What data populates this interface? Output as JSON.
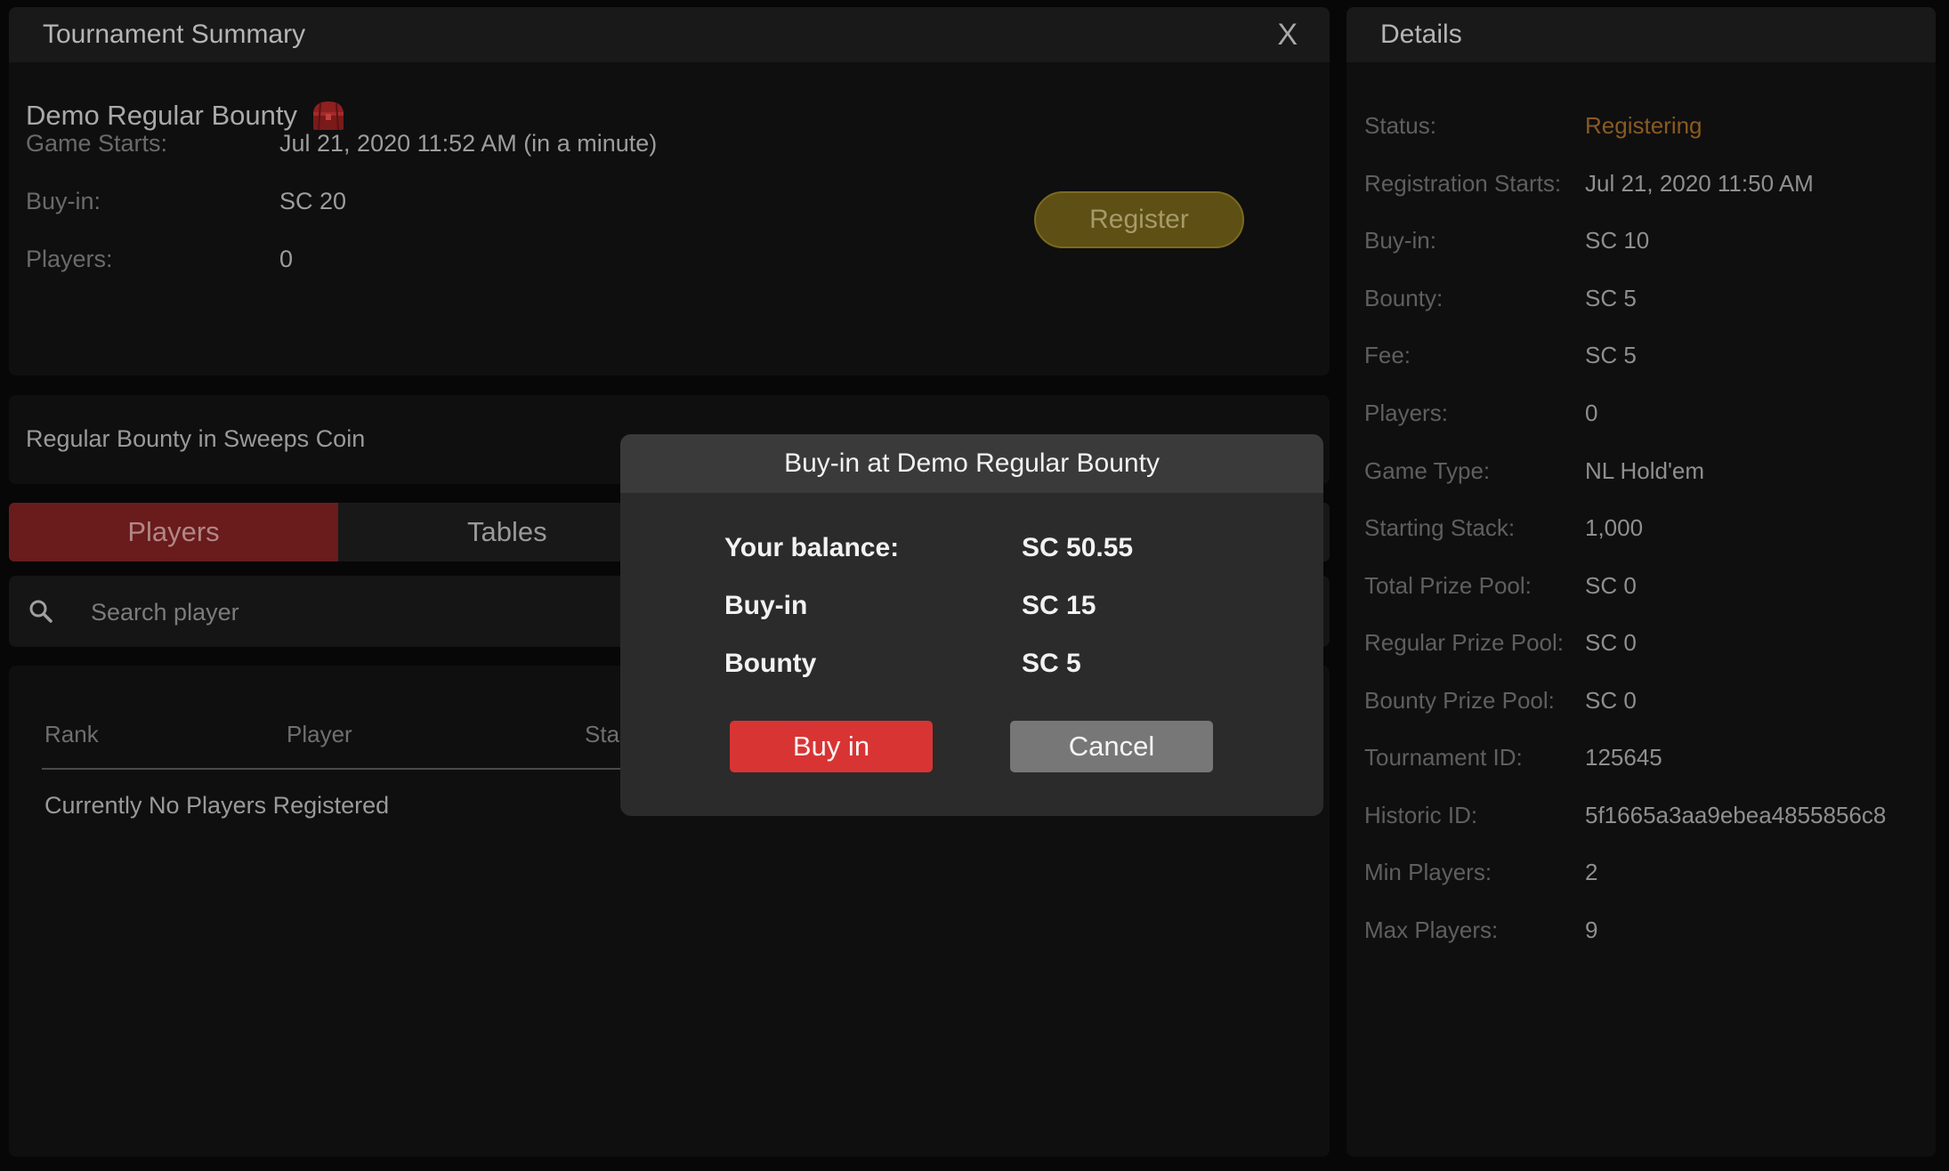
{
  "summary": {
    "title": "Tournament Summary",
    "close_label": "X",
    "tournament_name": "Demo Regular Bounty",
    "rows": [
      {
        "label": "Game Starts:",
        "value": "Jul 21, 2020 11:52 AM (in a minute)"
      },
      {
        "label": "Buy-in:",
        "value": "SC 20"
      },
      {
        "label": "Players:",
        "value": "0"
      }
    ],
    "register_label": "Register"
  },
  "description": "Regular Bounty in Sweeps Coin",
  "tabs": {
    "players": "Players",
    "tables": "Tables"
  },
  "search": {
    "placeholder": "Search player"
  },
  "table": {
    "headers": [
      "Rank",
      "Player",
      "Stack"
    ],
    "empty_message": "Currently No Players Registered"
  },
  "details": {
    "title": "Details",
    "rows": [
      {
        "label": "Status:",
        "value": "Registering"
      },
      {
        "label": "Registration Starts:",
        "value": "Jul 21, 2020 11:50 AM"
      },
      {
        "label": "Buy-in:",
        "value": "SC 10"
      },
      {
        "label": "Bounty:",
        "value": "SC 5"
      },
      {
        "label": "Fee:",
        "value": "SC 5"
      },
      {
        "label": "Players:",
        "value": "0"
      },
      {
        "label": "Game Type:",
        "value": "NL Hold'em"
      },
      {
        "label": "Starting Stack:",
        "value": "1,000"
      },
      {
        "label": "Total Prize Pool:",
        "value": "SC 0"
      },
      {
        "label": "Regular Prize Pool:",
        "value": "SC 0"
      },
      {
        "label": "Bounty Prize Pool:",
        "value": "SC 0"
      },
      {
        "label": "Tournament ID:",
        "value": "125645"
      },
      {
        "label": "Historic ID:",
        "value": "5f1665a3aa9ebea4855856c8"
      },
      {
        "label": "Min Players:",
        "value": "2"
      },
      {
        "label": "Max Players:",
        "value": "9"
      }
    ]
  },
  "modal": {
    "title": "Buy-in at Demo Regular Bounty",
    "rows": [
      {
        "label": "Your balance:",
        "value": "SC 50.55"
      },
      {
        "label": "Buy-in",
        "value": "SC 15"
      },
      {
        "label": "Bounty",
        "value": "SC 5"
      }
    ],
    "buyin_label": "Buy in",
    "cancel_label": "Cancel"
  },
  "colors": {
    "accent_red": "#d83434",
    "tab_active": "#6a1b1b",
    "register_gold": "#5e4f14",
    "status_orange": "#8a5a22"
  }
}
